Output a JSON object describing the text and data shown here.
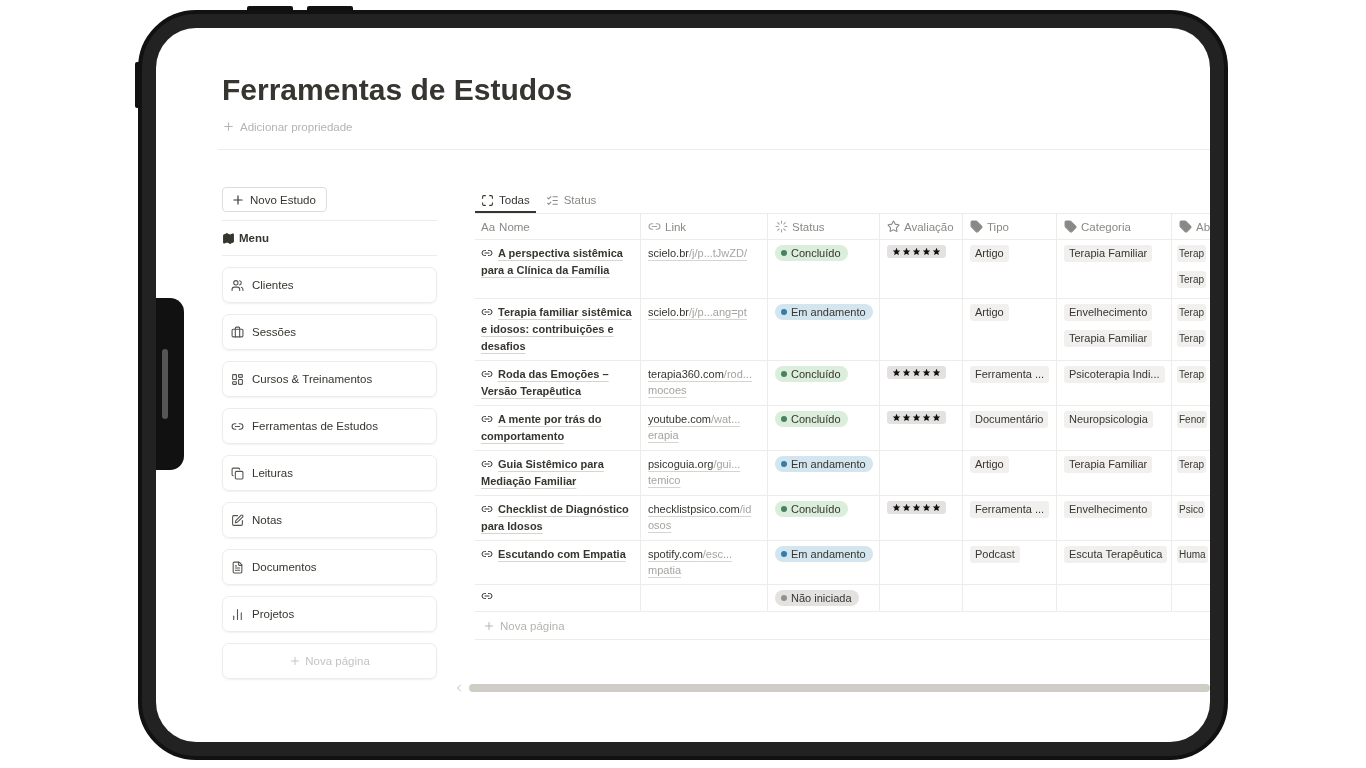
{
  "page": {
    "title": "Ferramentas de Estudos",
    "add_property": "Adicionar propriedade"
  },
  "sidebar": {
    "new_button": "Novo Estudo",
    "menu_label": "Menu",
    "new_page": "Nova página",
    "items": [
      {
        "label": "Clientes"
      },
      {
        "label": "Sessões"
      },
      {
        "label": "Cursos & Treinamentos"
      },
      {
        "label": "Ferramentas de Estudos"
      },
      {
        "label": "Leituras"
      },
      {
        "label": "Notas"
      },
      {
        "label": "Documentos"
      },
      {
        "label": "Projetos"
      }
    ]
  },
  "tabs": [
    {
      "label": "Todas",
      "selected": true
    },
    {
      "label": "Status",
      "selected": false
    }
  ],
  "table": {
    "columns": [
      {
        "label": "Nome",
        "kind": "title",
        "prefix": "Aa"
      },
      {
        "label": "Link",
        "kind": "url"
      },
      {
        "label": "Status",
        "kind": "status"
      },
      {
        "label": "Avaliação",
        "kind": "rating"
      },
      {
        "label": "Tipo",
        "kind": "select"
      },
      {
        "label": "Categoria",
        "kind": "multi"
      },
      {
        "label": "Ab",
        "kind": "multi"
      }
    ],
    "rows": [
      {
        "name": "A perspectiva sistêmica para a Clínica da Família",
        "link": {
          "domain": "scielo.br",
          "path": "/j/p...tJwZD/"
        },
        "status": {
          "label": "Concluído",
          "color": "#448361"
        },
        "stars": 5,
        "tipo": [
          "Artigo"
        ],
        "categoria": [
          "Terapia Familiar"
        ],
        "column_7": [
          "Terap",
          "Terap"
        ]
      },
      {
        "name": "Terapia familiar sistêmica e idosos: contribuições e desafios",
        "link": {
          "domain": "scielo.br",
          "path": "/j/p...ang=pt"
        },
        "status": {
          "label": "Em andamento",
          "color": "#337ea9"
        },
        "tipo": [
          "Artigo"
        ],
        "categoria": [
          "Envelhecimento",
          "Terapia Familiar"
        ],
        "column_7": [
          "Terap",
          "Terap"
        ]
      },
      {
        "name": "Roda das Emoções – Versão Terapêutica",
        "link": {
          "domain": "terapia360.com",
          "path": "/rod...",
          "rest": "mocoes"
        },
        "status": {
          "label": "Concluído",
          "color": "#448361"
        },
        "stars": 5,
        "tipo": [
          "Ferramenta ..."
        ],
        "categoria": [
          "Psicoterapia Indi..."
        ],
        "column_7": [
          "Terap"
        ]
      },
      {
        "name": "A mente por trás do comportamento",
        "link": {
          "domain": "youtube.com",
          "path": "/wat...",
          "rest": "erapia"
        },
        "status": {
          "label": "Concluído",
          "color": "#448361"
        },
        "stars": 5,
        "tipo": [
          "Documentário"
        ],
        "categoria": [
          "Neuropsicologia"
        ],
        "column_7": [
          "Fenor"
        ]
      },
      {
        "name": "Guia Sistêmico para Mediação Familiar",
        "link": {
          "domain": "psicoguia.org",
          "path": "/gui...",
          "rest": "temico"
        },
        "status": {
          "label": "Em andamento",
          "color": "#337ea9"
        },
        "tipo": [
          "Artigo"
        ],
        "categoria": [
          "Terapia Familiar"
        ],
        "column_7": [
          "Terap"
        ]
      },
      {
        "name": "Checklist de Diagnóstico para Idosos",
        "link": {
          "domain": "checklistpsico.com",
          "path": "/id",
          "rest": "osos"
        },
        "status": {
          "label": "Concluído",
          "color": "#448361"
        },
        "stars": 5,
        "tipo": [
          "Ferramenta ..."
        ],
        "categoria": [
          "Envelhecimento"
        ],
        "column_7": [
          "Psico"
        ]
      },
      {
        "name": "Escutando com Empatia",
        "link": {
          "domain": "spotify.com",
          "path": "/esc...",
          "rest": "mpatia"
        },
        "status": {
          "label": "Em andamento",
          "color": "#337ea9"
        },
        "tipo": [
          "Podcast"
        ],
        "categoria": [
          "Escuta Terapêutica"
        ],
        "column_7": [
          "Huma"
        ]
      },
      {
        "status": {
          "label": "Não iniciada",
          "color": "#91918e"
        }
      }
    ],
    "new_page": "Nova página"
  }
}
